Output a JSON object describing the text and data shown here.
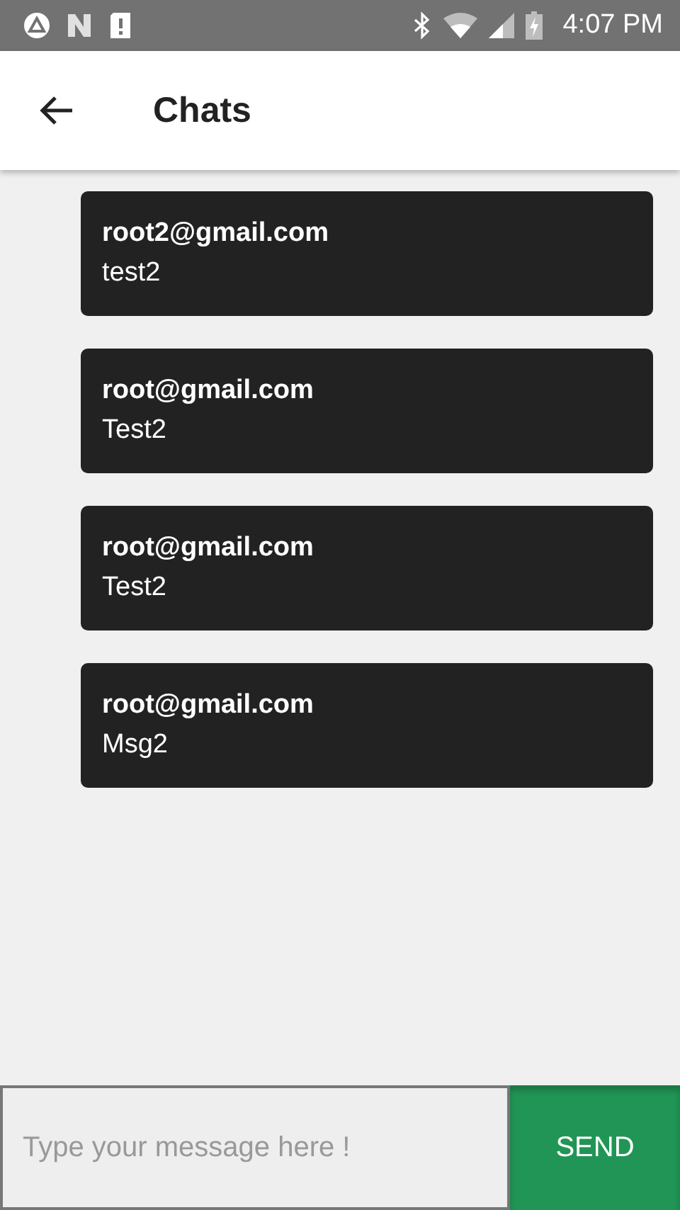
{
  "status_bar": {
    "time": "4:07 PM"
  },
  "app_bar": {
    "title": "Chats"
  },
  "messages": [
    {
      "sender": "root2@gmail.com",
      "text": "test2"
    },
    {
      "sender": "root@gmail.com",
      "text": "Test2"
    },
    {
      "sender": "root@gmail.com",
      "text": "Test2"
    },
    {
      "sender": "root@gmail.com",
      "text": "Msg2"
    }
  ],
  "composer": {
    "placeholder": "Type your message here !",
    "button": "SEND"
  }
}
